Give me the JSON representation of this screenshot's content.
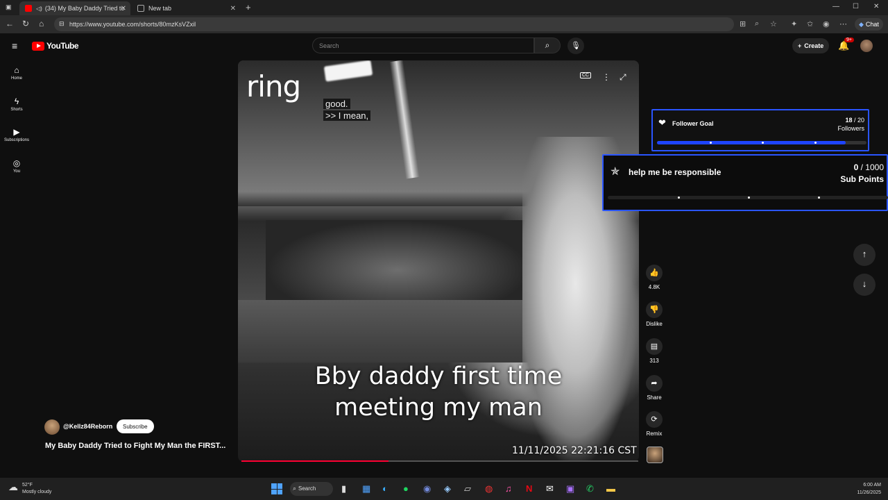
{
  "browser": {
    "tabs": [
      {
        "label": "(34) My Baby Daddy Tried to"
      },
      {
        "label": "New tab"
      }
    ],
    "url": "https://www.youtube.com/shorts/80mzKsVZxil",
    "chat_label": "Chat"
  },
  "header": {
    "logo_text": "YouTube",
    "search_placeholder": "Search",
    "create_label": "Create",
    "notification_count": "9+"
  },
  "sidebar": {
    "items": [
      {
        "label": "Home",
        "icon": "home-icon"
      },
      {
        "label": "Shorts",
        "icon": "shorts-icon"
      },
      {
        "label": "Subscriptions",
        "icon": "subscriptions-icon"
      },
      {
        "label": "You",
        "icon": "you-icon"
      }
    ]
  },
  "video": {
    "watermark": "ring",
    "cc_line1": "good.",
    "cc_line2": ">> I mean,",
    "caption": "Bby daddy first time meeting my man",
    "timestamp": "11/11/2025 22:21:16 CST",
    "progress": 0.37
  },
  "channel": {
    "handle": "@Kellz84Reborn",
    "subscribe_label": "Subscribe",
    "title": "My Baby Daddy Tried to Fight My Man the FIRST..."
  },
  "actions": {
    "like_count": "4.8K",
    "dislike_label": "Dislike",
    "comment_count": "313",
    "share_label": "Share",
    "remix_label": "Remix"
  },
  "widgets": {
    "follower_goal": {
      "title": "Follower Goal",
      "current": "18",
      "target": "/ 20",
      "unit": "Followers",
      "progress": 0.9
    },
    "sub_goal": {
      "title": "help me be responsible",
      "current": "0",
      "target": "/ 1000",
      "unit": "Sub Points",
      "progress": 0
    }
  },
  "taskbar": {
    "temperature": "52°F",
    "weather": "Mostly cloudy",
    "search_label": "Search",
    "time": "6:00 AM",
    "date": "11/26/2025"
  },
  "colors": {
    "accent_blue": "#2a55ff",
    "youtube_red": "#ff0000"
  }
}
